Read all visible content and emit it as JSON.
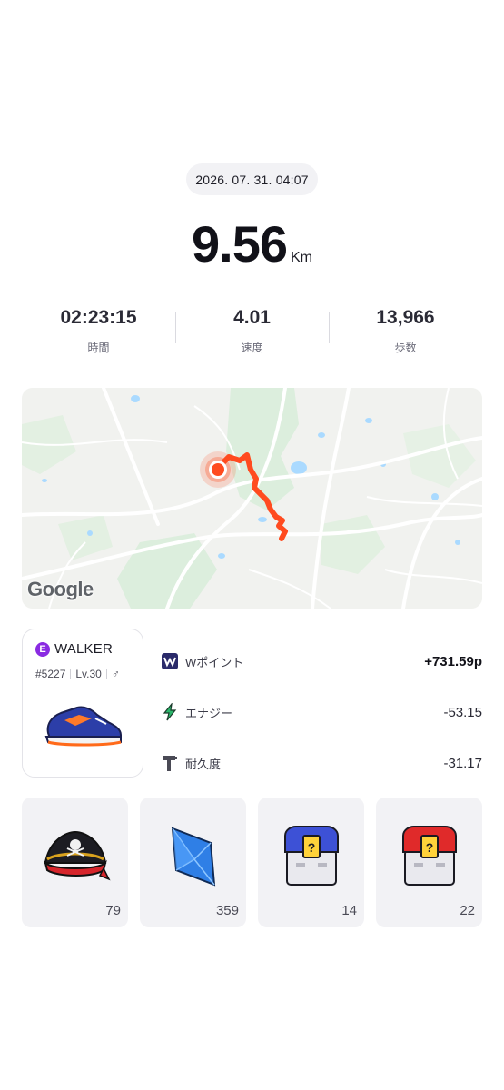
{
  "header": {
    "datetime": "2026. 07. 31. 04:07",
    "distance_value": "9.56",
    "distance_unit": "Km"
  },
  "stats": [
    {
      "value": "02:23:15",
      "label": "時間"
    },
    {
      "value": "4.01",
      "label": "速度"
    },
    {
      "value": "13,966",
      "label": "歩数"
    }
  ],
  "map": {
    "provider_logo": "Google",
    "route_color": "#ff4b1f"
  },
  "walker": {
    "badge_letter": "E",
    "name": "WALKER",
    "id": "#5227",
    "level": "Lv.30",
    "gender_symbol": "♂",
    "badge_color": "#8a2be2"
  },
  "rewards": [
    {
      "icon": "w-point-icon",
      "label": "Wポイント",
      "value": "+731.59p"
    },
    {
      "icon": "lightning-icon",
      "label": "エナジー",
      "value": "-53.15"
    },
    {
      "icon": "hammer-icon",
      "label": "耐久度",
      "value": "-31.17"
    }
  ],
  "items": [
    {
      "icon": "pirate-hat-icon",
      "count": "79"
    },
    {
      "icon": "blue-gem-icon",
      "count": "359"
    },
    {
      "icon": "blue-chest-icon",
      "count": "14"
    },
    {
      "icon": "red-chest-icon",
      "count": "22"
    }
  ]
}
